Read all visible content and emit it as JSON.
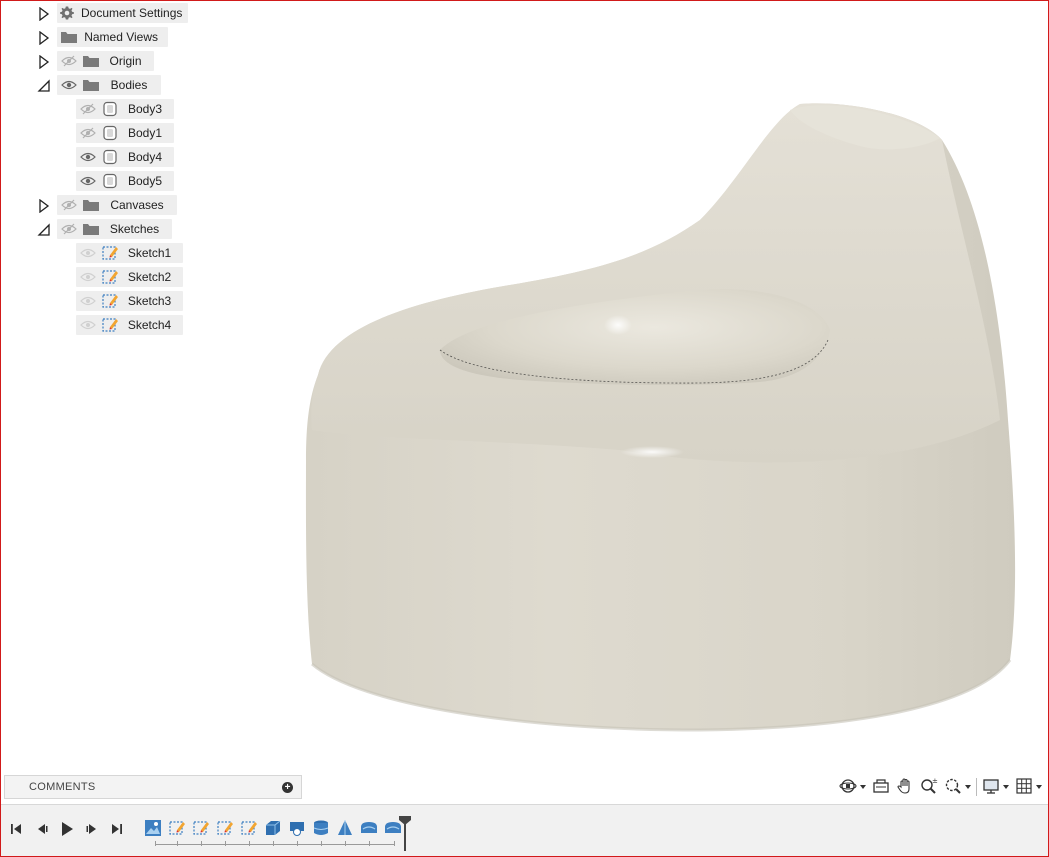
{
  "browser": {
    "items": [
      {
        "label": "Document Settings"
      },
      {
        "label": "Named Views"
      },
      {
        "label": "Origin"
      },
      {
        "label": "Bodies"
      },
      {
        "label": "Body3"
      },
      {
        "label": "Body1"
      },
      {
        "label": "Body4"
      },
      {
        "label": "Body5"
      },
      {
        "label": "Canvases"
      },
      {
        "label": "Sketches"
      },
      {
        "label": "Sketch1"
      },
      {
        "label": "Sketch2"
      },
      {
        "label": "Sketch3"
      },
      {
        "label": "Sketch4"
      }
    ]
  },
  "comments": {
    "title": "COMMENTS",
    "add_symbol": "+"
  },
  "colors": {
    "frame": "#d11a1a",
    "model": "#d8d4c8",
    "panel": "#eeeeee",
    "timeline": "#f1f1f1",
    "feature_blue": "#3d7fc1"
  },
  "icons": {
    "navbar": [
      "orbit-icon",
      "look-at-icon",
      "pan-icon",
      "zoom-icon",
      "fit-icon",
      "display-settings-icon",
      "grid-settings-icon"
    ],
    "playback": [
      "go-to-start-icon",
      "step-back-icon",
      "play-icon",
      "step-forward-icon",
      "go-to-end-icon"
    ],
    "timeline_features": [
      "canvas-feature-icon",
      "sketch-feature-icon",
      "sketch-feature-icon",
      "sketch-feature-icon",
      "sketch-feature-icon",
      "extrude-feature-icon",
      "split-body-feature-icon",
      "loft-feature-icon",
      "draft-feature-icon",
      "fillet-feature-icon",
      "fillet-feature-icon"
    ]
  }
}
